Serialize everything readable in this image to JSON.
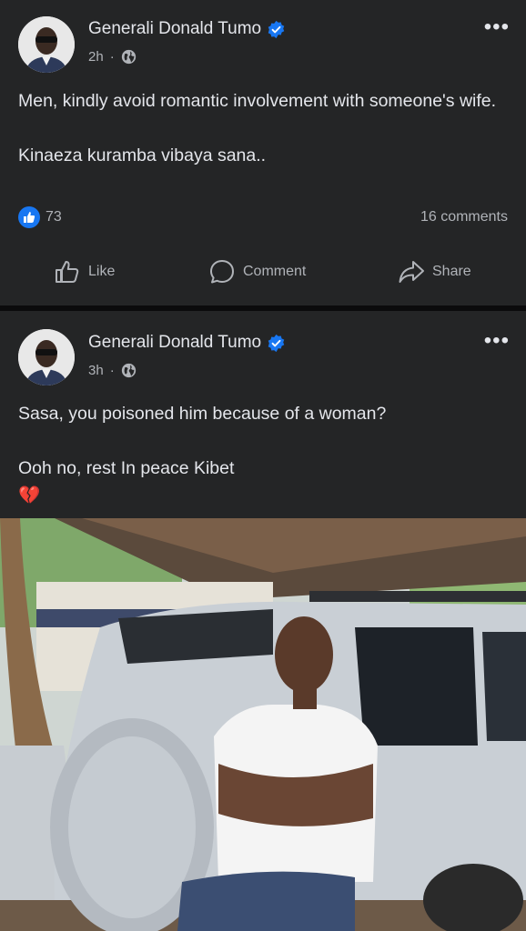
{
  "posts": [
    {
      "author": "Generali Donald Tumo",
      "time": "2h",
      "separator": "·",
      "verified": true,
      "audience_icon": "globe-icon",
      "text_lines": [
        "Men, kindly avoid romantic involvement with someone's wife.",
        "Kinaeza kuramba vibaya sana.."
      ],
      "reaction_count": "73",
      "comments": "16 comments",
      "actions": {
        "like": "Like",
        "comment": "Comment",
        "share": "Share"
      }
    },
    {
      "author": "Generali Donald Tumo",
      "time": "3h",
      "separator": "·",
      "verified": true,
      "audience_icon": "globe-icon",
      "text_lines": [
        "Sasa, you poisoned him because of a woman?",
        "Ooh no, rest In peace Kibet"
      ],
      "emoji": "💔"
    }
  ],
  "colors": {
    "card_bg": "#242526",
    "text_primary": "#e4e6eb",
    "text_secondary": "#b0b3b8",
    "accent_blue": "#1877f2"
  }
}
